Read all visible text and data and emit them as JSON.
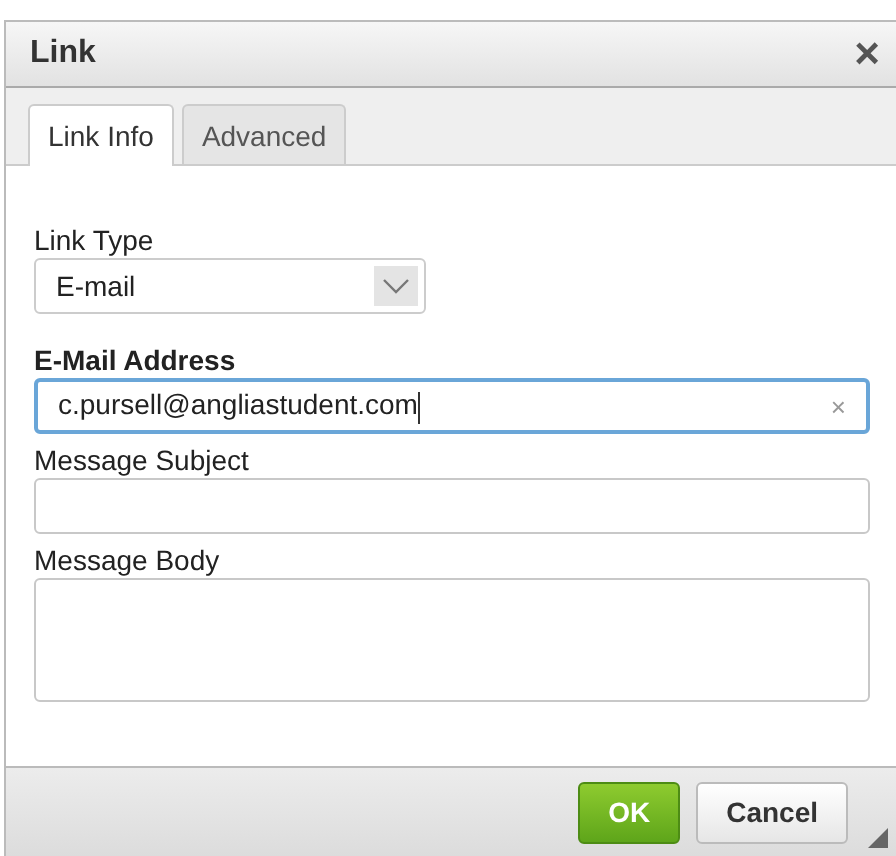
{
  "window": {
    "title": "Link",
    "close": "×"
  },
  "tabs": [
    {
      "label": "Link Info",
      "selected": true
    },
    {
      "label": "Advanced",
      "selected": false
    }
  ],
  "fields": [
    {
      "kind": "select",
      "label": "Link Type",
      "required": false,
      "value": "E-mail"
    },
    {
      "kind": "text",
      "label": "E-Mail Address",
      "required": true,
      "focused": true,
      "value": "c.pursell@angliastudent.com",
      "clear": "×"
    },
    {
      "kind": "text",
      "label": "Message Subject",
      "required": false,
      "focused": false
    },
    {
      "kind": "textarea",
      "label": "Message Body",
      "required": false
    }
  ],
  "buttons": [
    {
      "label": "OK",
      "kind": "primary"
    },
    {
      "label": "Cancel",
      "kind": "secondary"
    }
  ]
}
